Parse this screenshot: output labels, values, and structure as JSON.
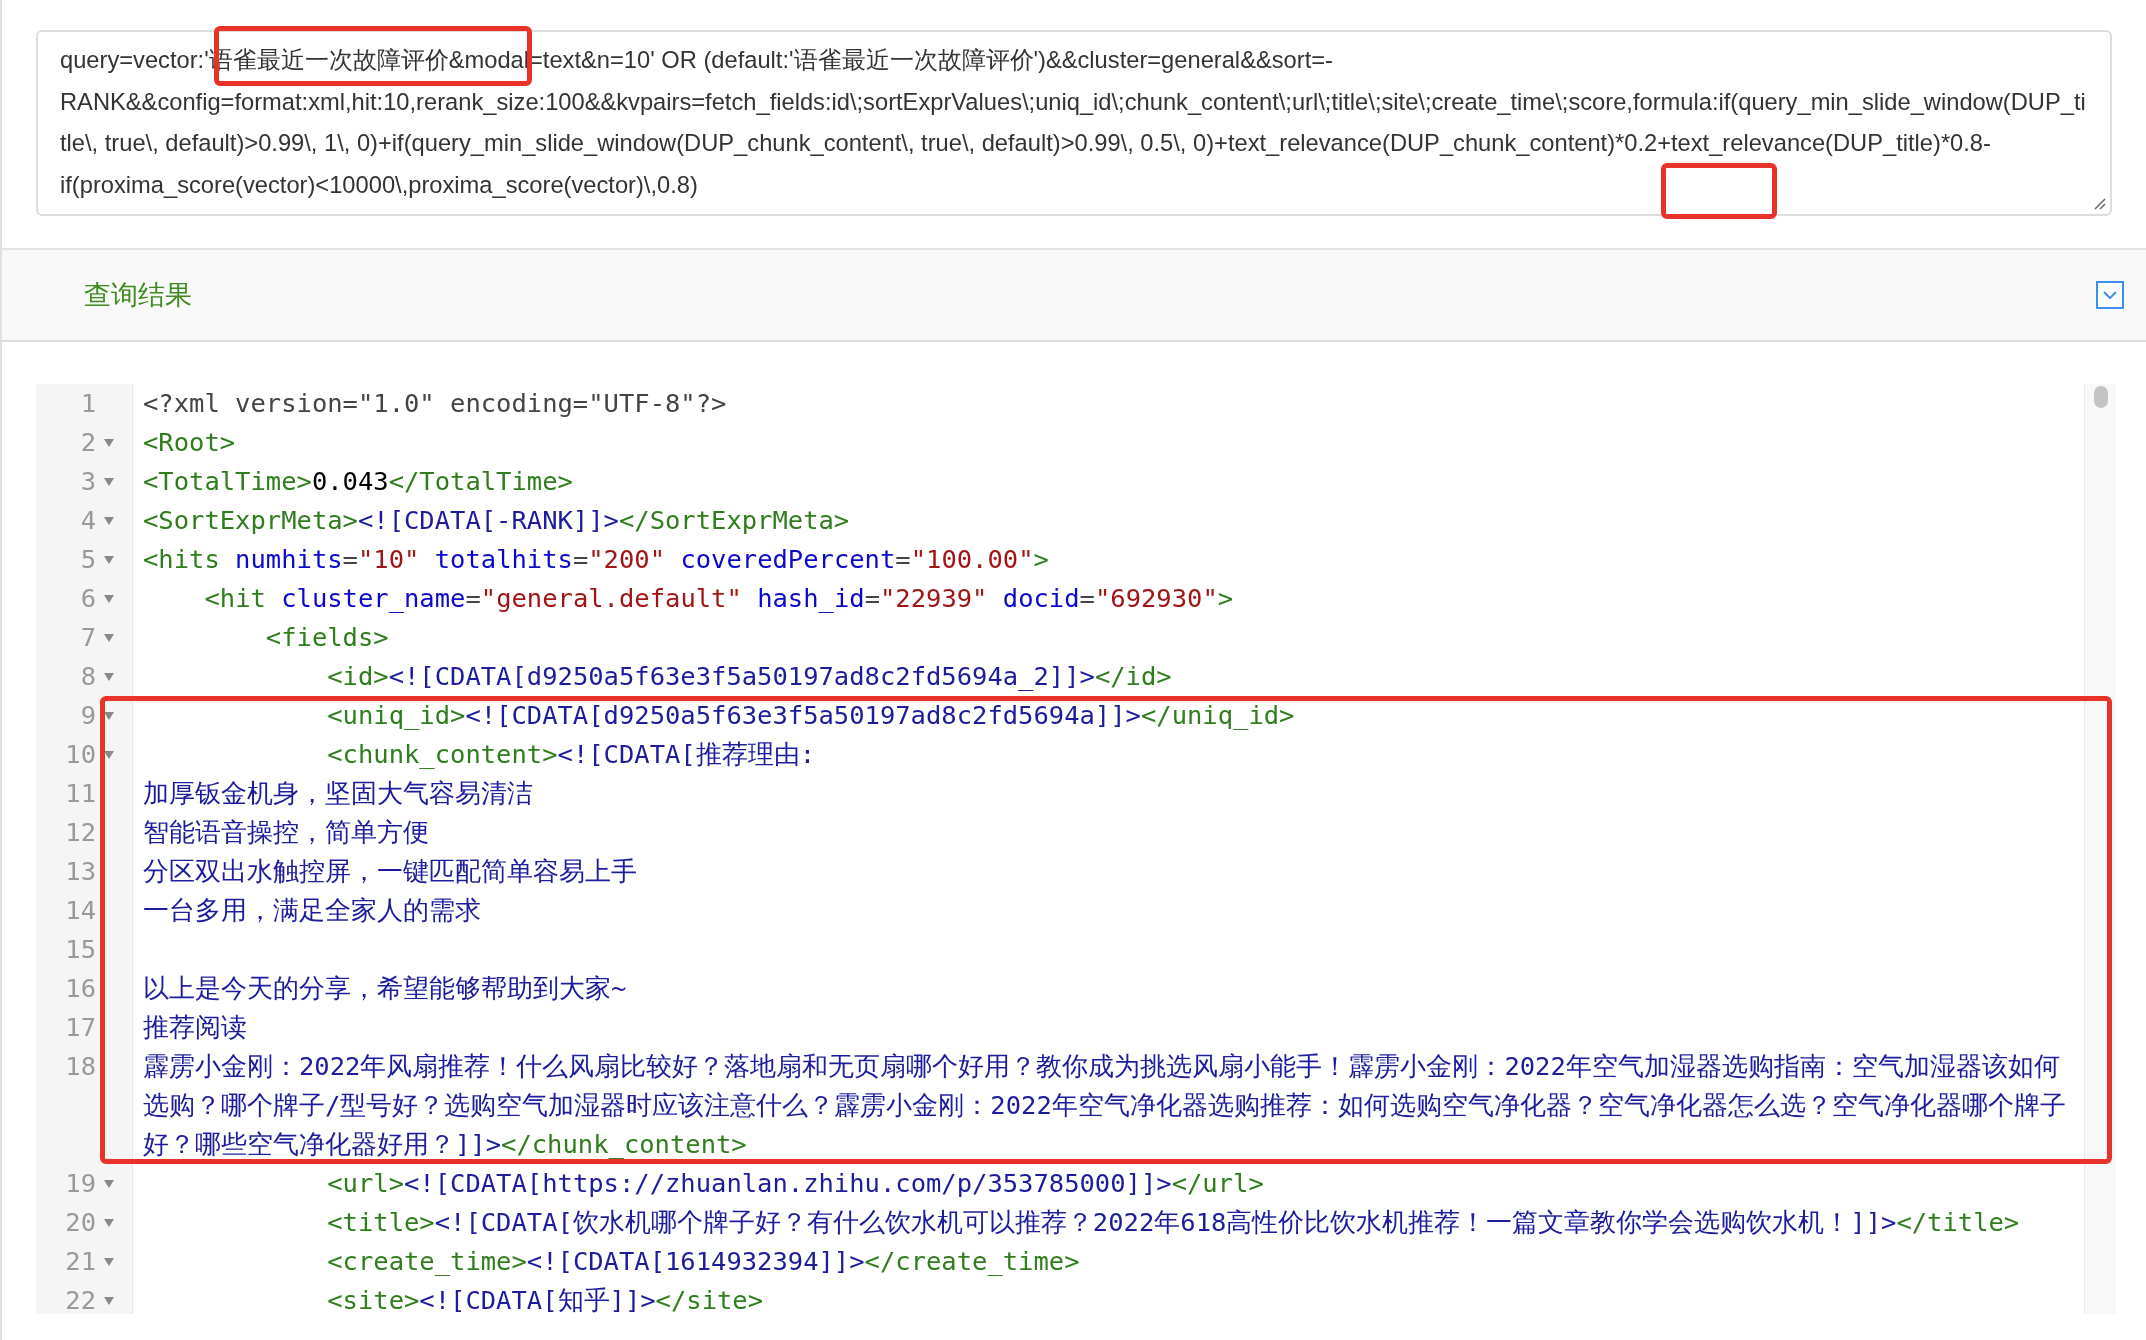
{
  "query_field": {
    "value": "query=vector:'语雀最近一次故障评价&modal=text&n=10' OR (default:'语雀最近一次故障评价')&&cluster=general&&sort=-RANK&&config=format:xml,hit:10,rerank_size:100&&kvpairs=fetch_fields:id\\;sortExprValues\\;uniq_id\\;chunk_content\\;url\\;title\\;site\\;create_time\\;score,formula:if(query_min_slide_window(DUP_title\\, true\\, default)>0.99\\, 1\\, 0)+if(query_min_slide_window(DUP_chunk_content\\, true\\, default)>0.99\\, 0.5\\, 0)+text_relevance(DUP_chunk_content)*0.2+text_relevance(DUP_title)*0.8-if(proxima_score(vector)<10000\\,proxima_score(vector)\\,0.8)"
  },
  "results_panel": {
    "title": "查询结果",
    "expanded": true
  },
  "code_lines": [
    {
      "number": "1",
      "foldable": false,
      "tokens": [
        {
          "kind": "plain",
          "text": "<?xml version=\"1.0\" encoding=\"UTF-8\"?>"
        }
      ]
    },
    {
      "number": "2",
      "foldable": true,
      "tokens": [
        {
          "kind": "tag",
          "text": "<Root>"
        }
      ]
    },
    {
      "number": "3",
      "foldable": true,
      "tokens": [
        {
          "kind": "tag",
          "text": "<TotalTime>"
        },
        {
          "kind": "text",
          "text": "0.043"
        },
        {
          "kind": "tag",
          "text": "</TotalTime>"
        }
      ]
    },
    {
      "number": "4",
      "foldable": true,
      "tokens": [
        {
          "kind": "tag",
          "text": "<SortExprMeta>"
        },
        {
          "kind": "cdata",
          "text": "<![CDATA[-RANK]]>"
        },
        {
          "kind": "tag",
          "text": "</SortExprMeta>"
        }
      ]
    },
    {
      "number": "5",
      "foldable": true,
      "tokens": [
        {
          "kind": "tag",
          "text": "<hits"
        },
        {
          "kind": "attr",
          "text": " numhits"
        },
        {
          "kind": "plain",
          "text": "="
        },
        {
          "kind": "value",
          "text": "\"10\""
        },
        {
          "kind": "attr",
          "text": " totalhits"
        },
        {
          "kind": "plain",
          "text": "="
        },
        {
          "kind": "value",
          "text": "\"200\""
        },
        {
          "kind": "attr",
          "text": " coveredPercent"
        },
        {
          "kind": "plain",
          "text": "="
        },
        {
          "kind": "value",
          "text": "\"100.00\""
        },
        {
          "kind": "tag",
          "text": ">"
        }
      ]
    },
    {
      "number": "6",
      "foldable": true,
      "tokens": [
        {
          "kind": "tag",
          "text": "    <hit"
        },
        {
          "kind": "attr",
          "text": " cluster_name"
        },
        {
          "kind": "plain",
          "text": "="
        },
        {
          "kind": "value",
          "text": "\"general.default\""
        },
        {
          "kind": "attr",
          "text": " hash_id"
        },
        {
          "kind": "plain",
          "text": "="
        },
        {
          "kind": "value",
          "text": "\"22939\""
        },
        {
          "kind": "attr",
          "text": " docid"
        },
        {
          "kind": "plain",
          "text": "="
        },
        {
          "kind": "value",
          "text": "\"692930\""
        },
        {
          "kind": "tag",
          "text": ">"
        }
      ]
    },
    {
      "number": "7",
      "foldable": true,
      "tokens": [
        {
          "kind": "tag",
          "text": "        <fields>"
        }
      ]
    },
    {
      "number": "8",
      "foldable": true,
      "tokens": [
        {
          "kind": "tag",
          "text": "            <id>"
        },
        {
          "kind": "cdata",
          "text": "<![CDATA[d9250a5f63e3f5a50197ad8c2fd5694a_2]]>"
        },
        {
          "kind": "tag",
          "text": "</id>"
        }
      ]
    },
    {
      "number": "9",
      "foldable": true,
      "tokens": [
        {
          "kind": "tag",
          "text": "            <uniq_id>"
        },
        {
          "kind": "cdata",
          "text": "<![CDATA[d9250a5f63e3f5a50197ad8c2fd5694a]]>"
        },
        {
          "kind": "tag",
          "text": "</uniq_id>"
        }
      ]
    },
    {
      "number": "10",
      "foldable": true,
      "tokens": [
        {
          "kind": "tag",
          "text": "            <chunk_content>"
        },
        {
          "kind": "cdata",
          "text": "<![CDATA[推荐理由:"
        }
      ]
    },
    {
      "number": "11",
      "foldable": false,
      "tokens": [
        {
          "kind": "cdata",
          "text": "加厚钣金机身，坚固大气容易清洁"
        }
      ]
    },
    {
      "number": "12",
      "foldable": false,
      "tokens": [
        {
          "kind": "cdata",
          "text": "智能语音操控，简单方便"
        }
      ]
    },
    {
      "number": "13",
      "foldable": false,
      "tokens": [
        {
          "kind": "cdata",
          "text": "分区双出水触控屏，一键匹配简单容易上手"
        }
      ]
    },
    {
      "number": "14",
      "foldable": false,
      "tokens": [
        {
          "kind": "cdata",
          "text": "一台多用，满足全家人的需求"
        }
      ]
    },
    {
      "number": "15",
      "foldable": false
    },
    {
      "number": "16",
      "foldable": false,
      "tokens": [
        {
          "kind": "cdata",
          "text": "以上是今天的分享，希望能够帮助到大家~"
        }
      ]
    },
    {
      "number": "17",
      "foldable": false,
      "tokens": [
        {
          "kind": "cdata",
          "text": "推荐阅读"
        }
      ]
    },
    {
      "number": "18",
      "foldable": false,
      "tokens": [
        {
          "kind": "cdata",
          "text": "霹雳小金刚：2022年风扇推荐！什么风扇比较好？落地扇和无页扇哪个好用？教你成为挑选风扇小能手！霹雳小金刚：2022年空气加湿器选购指南：空气加湿器该如何选购？哪个牌子/型号好？选购空气加湿器时应该注意什么？霹雳小金刚：2022年空气净化器选购推荐：如何选购空气净化器？空气净化器怎么选？空气净化器哪个牌子好？哪些空气净化器好用？]]>"
        },
        {
          "kind": "tag",
          "text": "</chunk_content>"
        }
      ]
    },
    {
      "number": "19",
      "foldable": true,
      "tokens": [
        {
          "kind": "tag",
          "text": "            <url>"
        },
        {
          "kind": "cdata",
          "text": "<![CDATA[https://zhuanlan.zhihu.com/p/353785000]]>"
        },
        {
          "kind": "tag",
          "text": "</url>"
        }
      ]
    },
    {
      "number": "20",
      "foldable": true,
      "tokens": [
        {
          "kind": "tag",
          "text": "            <title>"
        },
        {
          "kind": "cdata",
          "text": "<![CDATA[饮水机哪个牌子好？有什么饮水机可以推荐？2022年618高性价比饮水机推荐！一篇文章教你学会选购饮水机！]]>"
        },
        {
          "kind": "tag",
          "text": "</title>"
        }
      ]
    },
    {
      "number": "21",
      "foldable": true,
      "tokens": [
        {
          "kind": "tag",
          "text": "            <create_time>"
        },
        {
          "kind": "cdata",
          "text": "<![CDATA[1614932394]]>"
        },
        {
          "kind": "tag",
          "text": "</create_time>"
        }
      ]
    },
    {
      "number": "22",
      "foldable": true,
      "tokens": [
        {
          "kind": "tag",
          "text": "            <site>"
        },
        {
          "kind": "cdata",
          "text": "<![CDATA[知乎]]>"
        },
        {
          "kind": "tag",
          "text": "</site>"
        }
      ]
    }
  ],
  "annotations": [
    {
      "kind": "highlight"
    },
    {
      "kind": "highlight"
    },
    {
      "kind": "highlight"
    }
  ]
}
